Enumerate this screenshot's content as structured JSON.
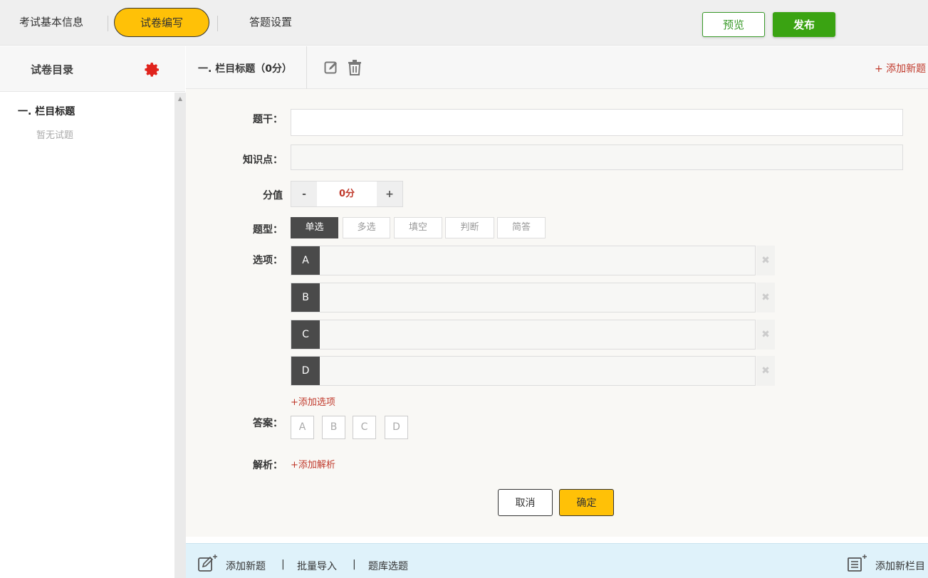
{
  "tabs": {
    "basic_info": "考试基本信息",
    "paper_edit": "试卷编写",
    "answer_settings": "答题设置"
  },
  "top_actions": {
    "preview": "预览",
    "publish": "发布"
  },
  "sidebar": {
    "title": "试卷目录",
    "section_name": "一. 栏目标题",
    "empty_text": "暂无试题"
  },
  "content_header": {
    "section_title": "一.  栏目标题（0分）",
    "add_new_question": "+ 添加新题"
  },
  "form": {
    "stem_label": "题干：",
    "stem_value": "",
    "knowledge_label": "知识点：",
    "knowledge_value": "",
    "score_label": "分值",
    "score_minus": "-",
    "score_value": "0分",
    "score_plus": "+",
    "type_label": "题型：",
    "types": [
      "单选",
      "多选",
      "填空",
      "判断",
      "简答"
    ],
    "options_label": "选项：",
    "options": [
      "A",
      "B",
      "C",
      "D"
    ],
    "option_delete": "✖",
    "add_option": "+添加选项",
    "answer_label": "答案：",
    "answers": [
      "A",
      "B",
      "C",
      "D"
    ],
    "analysis_label": "解析：",
    "add_analysis": "+添加解析",
    "cancel": "取消",
    "confirm": "确定"
  },
  "bottom_bar": {
    "add_question": "添加新题",
    "separator": "|",
    "batch_import": "批量导入",
    "bank_select": "题库选题",
    "add_section": "添加新栏目"
  },
  "colors": {
    "accent_yellow": "#ffc107",
    "publish_green": "#3aa312",
    "link_red": "#c0392b",
    "gear_red": "#e0231c"
  }
}
